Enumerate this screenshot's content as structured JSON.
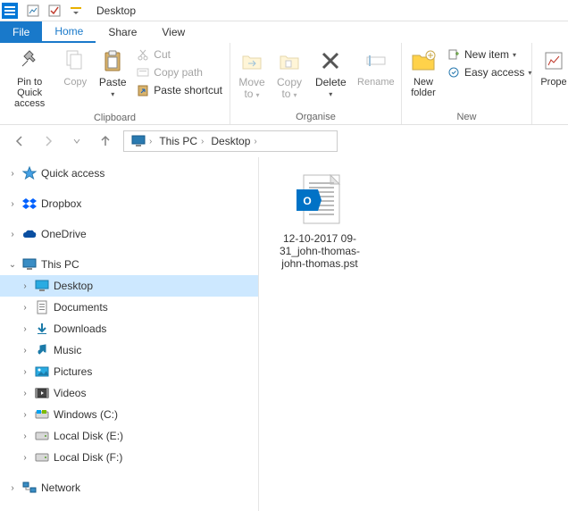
{
  "titlebar": {
    "title": "Desktop"
  },
  "tabs": {
    "file": "File",
    "home": "Home",
    "share": "Share",
    "view": "View"
  },
  "ribbon": {
    "clipboard": {
      "label": "Clipboard",
      "pin": "Pin to Quick\naccess",
      "copy": "Copy",
      "paste": "Paste",
      "cut": "Cut",
      "copy_path": "Copy path",
      "paste_sc": "Paste shortcut"
    },
    "organise": {
      "label": "Organise",
      "move_to": "Move\nto",
      "copy_to": "Copy\nto",
      "delete": "Delete",
      "rename": "Rename"
    },
    "new": {
      "label": "New",
      "new_folder": "New\nfolder",
      "new_item": "New item",
      "easy_access": "Easy access"
    },
    "open": {
      "properties": "Prope"
    }
  },
  "breadcrumb": {
    "pc": "This PC",
    "desktop": "Desktop"
  },
  "tree": {
    "quick_access": "Quick access",
    "dropbox": "Dropbox",
    "onedrive": "OneDrive",
    "this_pc": "This PC",
    "desktop": "Desktop",
    "documents": "Documents",
    "downloads": "Downloads",
    "music": "Music",
    "pictures": "Pictures",
    "videos": "Videos",
    "windows_c": "Windows (C:)",
    "local_e": "Local Disk (E:)",
    "local_f": "Local Disk (F:)",
    "network": "Network"
  },
  "file": {
    "name": "12-10-2017 09-31_john-thomas-john-thomas.pst"
  }
}
